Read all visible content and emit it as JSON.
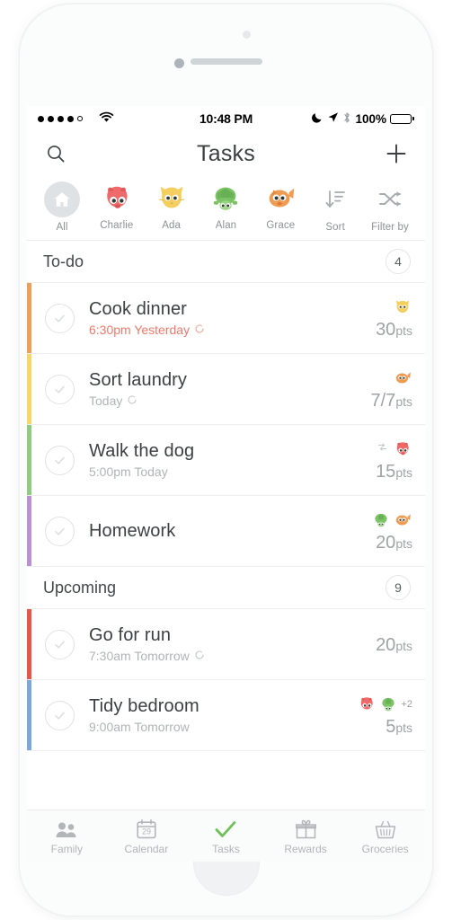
{
  "device": {
    "name": "iphone-white"
  },
  "status_bar": {
    "signal_dots_filled": 4,
    "signal_dots_total": 5,
    "wifi_icon": "wifi-icon",
    "time": "10:48 PM",
    "dnd_icon": "moon-icon",
    "location_icon": "location-arrow-icon",
    "bluetooth_icon": "bluetooth-icon",
    "battery_percent": "100%"
  },
  "nav": {
    "search_icon": "search-icon",
    "title": "Tasks",
    "add_icon": "plus-icon"
  },
  "filters": [
    {
      "label": "All",
      "type": "home",
      "color": "#dfe2e5",
      "selected": true
    },
    {
      "label": "Charlie",
      "type": "pig",
      "color": "#ef6a6a",
      "selected": false
    },
    {
      "label": "Ada",
      "type": "cat",
      "color": "#f4ce5e",
      "selected": false
    },
    {
      "label": "Alan",
      "type": "turtle",
      "color": "#7cc267",
      "selected": false
    },
    {
      "label": "Grace",
      "type": "fish",
      "color": "#ef9b52",
      "selected": false
    },
    {
      "label": "Sort",
      "type": "sort-icon",
      "color": "#a8acb0",
      "selected": false
    },
    {
      "label": "Filter by",
      "type": "shuffle-icon",
      "color": "#a8acb0",
      "selected": false
    }
  ],
  "sections": [
    {
      "title": "To-do",
      "count": "4",
      "tasks": [
        {
          "title": "Cook dinner",
          "subtitle": "6:30pm Yesterday",
          "overdue": true,
          "repeating": true,
          "accent": "#efa058",
          "points": "30",
          "points_unit": "pts",
          "assignees": [
            "cat"
          ],
          "more": "",
          "swap": false
        },
        {
          "title": "Sort laundry",
          "subtitle": "Today",
          "overdue": false,
          "repeating": true,
          "accent": "#f7d768",
          "points": "7/7",
          "points_unit": "pts",
          "assignees": [
            "fish"
          ],
          "more": "",
          "swap": false
        },
        {
          "title": "Walk the dog",
          "subtitle": "5:00pm Today",
          "overdue": false,
          "repeating": false,
          "accent": "#8fcc7f",
          "points": "15",
          "points_unit": "pts",
          "assignees": [
            "pig"
          ],
          "more": "",
          "swap": true
        },
        {
          "title": "Homework",
          "subtitle": "",
          "overdue": false,
          "repeating": false,
          "accent": "#bb8fd4",
          "points": "20",
          "points_unit": "pts",
          "assignees": [
            "turtle",
            "fish"
          ],
          "more": "",
          "swap": false
        }
      ]
    },
    {
      "title": "Upcoming",
      "count": "9",
      "tasks": [
        {
          "title": "Go for run",
          "subtitle": "7:30am Tomorrow",
          "overdue": false,
          "repeating": true,
          "accent": "#e8564a",
          "points": "20",
          "points_unit": "pts",
          "assignees": [],
          "more": "",
          "swap": false
        },
        {
          "title": "Tidy bedroom",
          "subtitle": "9:00am Tomorrow",
          "overdue": false,
          "repeating": false,
          "accent": "#7ba7dc",
          "points": "5",
          "points_unit": "pts",
          "assignees": [
            "pig",
            "turtle"
          ],
          "more": "+2",
          "swap": false
        }
      ]
    }
  ],
  "tabs": [
    {
      "label": "Family",
      "icon": "family-icon",
      "active": false
    },
    {
      "label": "Calendar",
      "icon": "calendar-icon",
      "active": false,
      "day": "29"
    },
    {
      "label": "Tasks",
      "icon": "check-icon",
      "active": true
    },
    {
      "label": "Rewards",
      "icon": "gift-icon",
      "active": false
    },
    {
      "label": "Groceries",
      "icon": "basket-icon",
      "active": false
    }
  ],
  "colors": {
    "accent_green": "#6fc05a",
    "overdue_red": "#f2786b",
    "muted": "#b0b4b6"
  }
}
